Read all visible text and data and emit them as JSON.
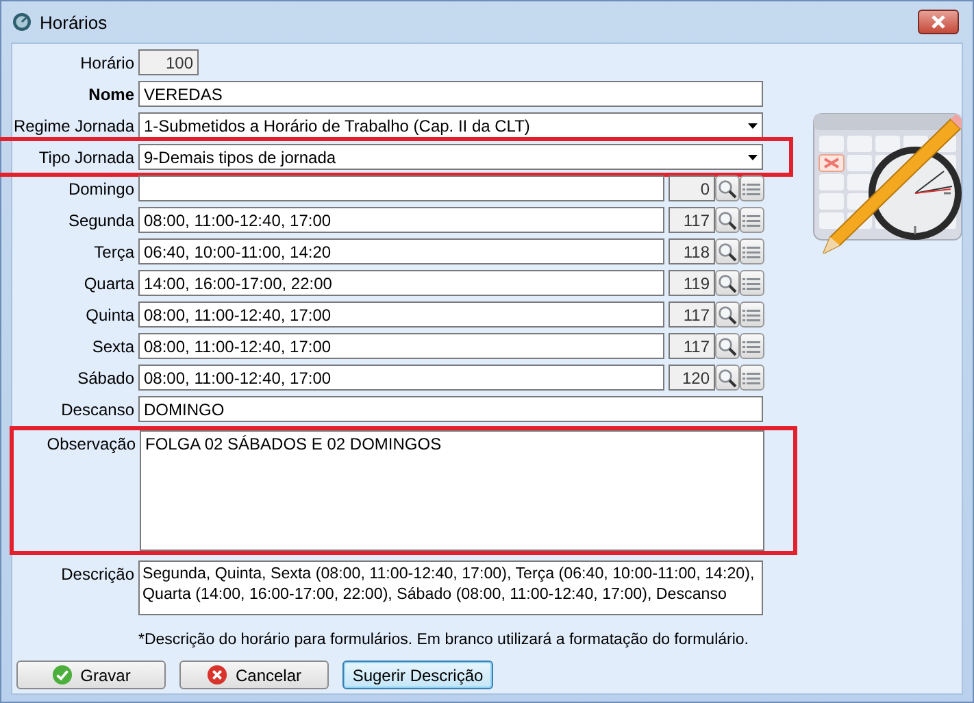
{
  "window": {
    "title": "Horários"
  },
  "code": {
    "label": "Horário",
    "value": "100"
  },
  "name": {
    "label": "Nome",
    "value": "VEREDAS"
  },
  "selects": [
    {
      "label": "Regime Jornada",
      "value": "1-Submetidos a Horário de Trabalho (Cap. II da CLT)",
      "highlighted": false
    },
    {
      "label": "Tipo Jornada",
      "value": "9-Demais tipos de jornada",
      "highlighted": true
    }
  ],
  "days": [
    {
      "label": "Domingo",
      "count": "0"
    },
    {
      "label": "Segunda",
      "value": "08:00, 11:00-12:40, 17:00",
      "count": "117"
    },
    {
      "label": "Terça",
      "value": "06:40, 10:00-11:00, 14:20",
      "count": "118"
    },
    {
      "label": "Quarta",
      "value": "14:00, 16:00-17:00, 22:00",
      "count": "119"
    },
    {
      "label": "Quinta",
      "value": "08:00, 11:00-12:40, 17:00",
      "count": "117"
    },
    {
      "label": "Sexta",
      "value": "08:00, 11:00-12:40, 17:00",
      "count": "117"
    },
    {
      "label": "Sábado",
      "value": "08:00, 11:00-12:40, 17:00",
      "count": "120"
    }
  ],
  "rest": {
    "label": "Descanso",
    "value": "DOMINGO"
  },
  "notes": {
    "label": "Observação",
    "value": "FOLGA 02 SÁBADOS E 02 DOMINGOS",
    "highlighted": true
  },
  "description": {
    "label": "Descrição",
    "value": "Segunda, Quinta, Sexta (08:00, 11:00-12:40, 17:00), Terça (06:40, 10:00-11:00, 14:20), Quarta (14:00, 16:00-17:00, 22:00), Sábado (08:00, 11:00-12:40, 17:00), Descanso"
  },
  "hint": "*Descrição do horário para formulários. Em branco utilizará a formatação do formulário.",
  "buttons": [
    {
      "label": "Gravar",
      "kind": "ok",
      "focused": false
    },
    {
      "label": "Cancelar",
      "kind": "cancel",
      "focused": false
    },
    {
      "label": "Sugerir Descrição",
      "kind": "plain",
      "focused": true
    }
  ]
}
